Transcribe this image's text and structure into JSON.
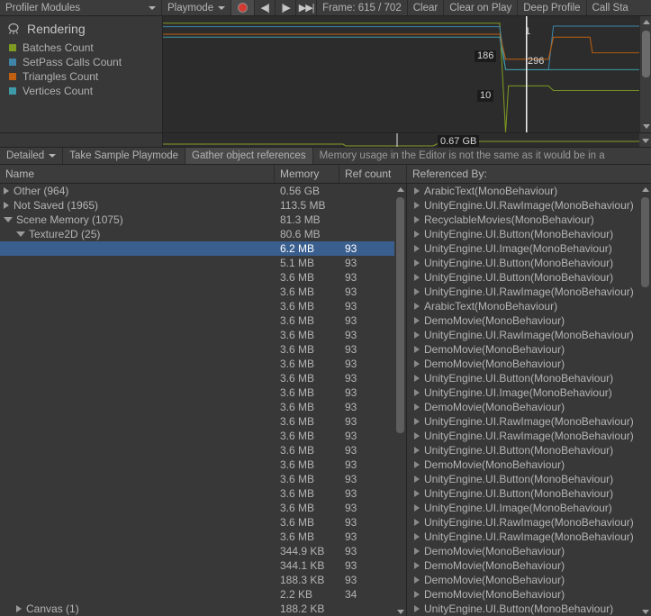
{
  "toolbar": {
    "modules_label": "Profiler Modules",
    "playmode_label": "Playmode",
    "record_icon": "record-icon",
    "prev_frame_icon": "previous-frame-icon",
    "next_frame_icon": "next-frame-icon",
    "last_frame_icon": "last-frame-icon",
    "frame_label": "Frame: 615 / 702",
    "clear_label": "Clear",
    "clear_on_play_label": "Clear on Play",
    "deep_profile_label": "Deep Profile",
    "call_stacks_label": "Call Sta"
  },
  "module": {
    "icon": "rendering-module-icon",
    "title": "Rendering",
    "counters": [
      {
        "label": "Batches Count",
        "color": "#7f9a22"
      },
      {
        "label": "SetPass Calls Count",
        "color": "#3e85a8"
      },
      {
        "label": "Triangles Count",
        "color": "#c06010"
      },
      {
        "label": "Vertices Count",
        "color": "#3e9aa8"
      }
    ]
  },
  "chart_data": {
    "type": "line",
    "title": "Rendering",
    "xlabel": "",
    "ylabel": "",
    "grid": false,
    "legend_position": "left-panel",
    "current_frame": 615,
    "total_frames": 702,
    "playhead_x_frac": 0.745,
    "series": [
      {
        "name": "Batches Count",
        "color": "#7f9a22",
        "current_value": 10,
        "label": "10",
        "points": [
          [
            0.0,
            0.06
          ],
          [
            0.69,
            0.06
          ],
          [
            0.702,
            1.0
          ],
          [
            0.708,
            0.6
          ],
          [
            0.79,
            0.6
          ],
          [
            0.8,
            0.64
          ],
          [
            0.875,
            0.64
          ],
          [
            1.0,
            0.64
          ]
        ]
      },
      {
        "name": "SetPass Calls Count",
        "color": "#3e85a8",
        "current_value": 296,
        "label": "296",
        "points": [
          [
            0.0,
            0.09
          ],
          [
            0.69,
            0.09
          ],
          [
            0.702,
            0.46
          ],
          [
            0.79,
            0.46
          ],
          [
            0.8,
            0.085
          ],
          [
            1.0,
            0.085
          ]
        ]
      },
      {
        "name": "Triangles Count",
        "color": "#c06010",
        "current_value": 186,
        "label": "186",
        "points": [
          [
            0.0,
            0.155
          ],
          [
            0.69,
            0.155
          ],
          [
            0.702,
            0.37
          ],
          [
            0.79,
            0.37
          ],
          [
            0.8,
            0.18
          ],
          [
            0.875,
            0.18
          ],
          [
            0.88,
            0.315
          ],
          [
            1.0,
            0.315
          ]
        ]
      },
      {
        "name": "Vertices Count",
        "color": "#3e9aa8",
        "current_value": 1,
        "label": "1",
        "points": [
          [
            0.0,
            0.18
          ],
          [
            0.69,
            0.18
          ],
          [
            0.702,
            0.46
          ],
          [
            1.0,
            0.46
          ]
        ]
      }
    ],
    "value_labels": [
      {
        "text": "1",
        "x_frac": 0.755,
        "y_frac": 0.085,
        "style": "plain"
      },
      {
        "text": "186",
        "x_frac": 0.655,
        "y_frac": 0.295,
        "style": "boxed"
      },
      {
        "text": "296",
        "x_frac": 0.76,
        "y_frac": 0.335,
        "style": "plain"
      },
      {
        "text": "10",
        "x_frac": 0.66,
        "y_frac": 0.63,
        "style": "boxed"
      }
    ]
  },
  "memory_chart": {
    "type": "area",
    "label": "0.67 GB",
    "label_x_frac": 0.58
  },
  "toolbar2": {
    "detailed_label": "Detailed",
    "take_sample_label": "Take Sample Playmode",
    "gather_refs_label": "Gather object references",
    "note": "Memory usage in the Editor is not the same as it would be in a "
  },
  "table": {
    "headers": {
      "name": "Name",
      "memory": "Memory",
      "ref_count": "Ref count",
      "referenced_by": "Referenced By:"
    },
    "rows": [
      {
        "name": "Other (964)",
        "indent": 0,
        "fold": "closed",
        "memory": "0.56 GB",
        "ref": "",
        "selected": false
      },
      {
        "name": "Not Saved (1965)",
        "indent": 0,
        "fold": "closed",
        "memory": "113.5 MB",
        "ref": "",
        "selected": false
      },
      {
        "name": "Scene Memory (1075)",
        "indent": 0,
        "fold": "open",
        "memory": "81.3 MB",
        "ref": "",
        "selected": false
      },
      {
        "name": "Texture2D (25)",
        "indent": 1,
        "fold": "open",
        "memory": "80.6 MB",
        "ref": "",
        "selected": false
      },
      {
        "name": "",
        "indent": 2,
        "fold": "none",
        "memory": "6.2 MB",
        "ref": "93",
        "selected": true
      },
      {
        "name": "",
        "indent": 2,
        "fold": "none",
        "memory": "5.1 MB",
        "ref": "93",
        "selected": false
      },
      {
        "name": "",
        "indent": 2,
        "fold": "none",
        "memory": "3.6 MB",
        "ref": "93",
        "selected": false
      },
      {
        "name": "",
        "indent": 2,
        "fold": "none",
        "memory": "3.6 MB",
        "ref": "93",
        "selected": false
      },
      {
        "name": "",
        "indent": 2,
        "fold": "none",
        "memory": "3.6 MB",
        "ref": "93",
        "selected": false
      },
      {
        "name": "",
        "indent": 2,
        "fold": "none",
        "memory": "3.6 MB",
        "ref": "93",
        "selected": false
      },
      {
        "name": "",
        "indent": 2,
        "fold": "none",
        "memory": "3.6 MB",
        "ref": "93",
        "selected": false
      },
      {
        "name": "",
        "indent": 2,
        "fold": "none",
        "memory": "3.6 MB",
        "ref": "93",
        "selected": false
      },
      {
        "name": "",
        "indent": 2,
        "fold": "none",
        "memory": "3.6 MB",
        "ref": "93",
        "selected": false
      },
      {
        "name": "",
        "indent": 2,
        "fold": "none",
        "memory": "3.6 MB",
        "ref": "93",
        "selected": false
      },
      {
        "name": "",
        "indent": 2,
        "fold": "none",
        "memory": "3.6 MB",
        "ref": "93",
        "selected": false
      },
      {
        "name": "",
        "indent": 2,
        "fold": "none",
        "memory": "3.6 MB",
        "ref": "93",
        "selected": false
      },
      {
        "name": "",
        "indent": 2,
        "fold": "none",
        "memory": "3.6 MB",
        "ref": "93",
        "selected": false
      },
      {
        "name": "",
        "indent": 2,
        "fold": "none",
        "memory": "3.6 MB",
        "ref": "93",
        "selected": false
      },
      {
        "name": "",
        "indent": 2,
        "fold": "none",
        "memory": "3.6 MB",
        "ref": "93",
        "selected": false
      },
      {
        "name": "",
        "indent": 2,
        "fold": "none",
        "memory": "3.6 MB",
        "ref": "93",
        "selected": false
      },
      {
        "name": "",
        "indent": 2,
        "fold": "none",
        "memory": "3.6 MB",
        "ref": "93",
        "selected": false
      },
      {
        "name": "",
        "indent": 2,
        "fold": "none",
        "memory": "3.6 MB",
        "ref": "93",
        "selected": false
      },
      {
        "name": "",
        "indent": 2,
        "fold": "none",
        "memory": "3.6 MB",
        "ref": "93",
        "selected": false
      },
      {
        "name": "",
        "indent": 2,
        "fold": "none",
        "memory": "3.6 MB",
        "ref": "93",
        "selected": false
      },
      {
        "name": "",
        "indent": 2,
        "fold": "none",
        "memory": "3.6 MB",
        "ref": "93",
        "selected": false
      },
      {
        "name": "",
        "indent": 2,
        "fold": "none",
        "memory": "344.9 KB",
        "ref": "93",
        "selected": false
      },
      {
        "name": "",
        "indent": 2,
        "fold": "none",
        "memory": "344.1 KB",
        "ref": "93",
        "selected": false
      },
      {
        "name": "",
        "indent": 2,
        "fold": "none",
        "memory": "188.3 KB",
        "ref": "93",
        "selected": false
      },
      {
        "name": "",
        "indent": 2,
        "fold": "none",
        "memory": "2.2 KB",
        "ref": "34",
        "selected": false
      },
      {
        "name": "Canvas (1)",
        "indent": 1,
        "fold": "closed",
        "memory": "188.2 KB",
        "ref": "",
        "selected": false
      }
    ],
    "referenced_by": [
      "ArabicText(MonoBehaviour)",
      "UnityEngine.UI.RawImage(MonoBehaviour)",
      "RecyclableMovies(MonoBehaviour)",
      "UnityEngine.UI.Button(MonoBehaviour)",
      "UnityEngine.UI.Image(MonoBehaviour)",
      "UnityEngine.UI.Button(MonoBehaviour)",
      "UnityEngine.UI.Button(MonoBehaviour)",
      "UnityEngine.UI.RawImage(MonoBehaviour)",
      "ArabicText(MonoBehaviour)",
      "DemoMovie(MonoBehaviour)",
      "UnityEngine.UI.RawImage(MonoBehaviour)",
      "DemoMovie(MonoBehaviour)",
      "DemoMovie(MonoBehaviour)",
      "UnityEngine.UI.Button(MonoBehaviour)",
      "UnityEngine.UI.Image(MonoBehaviour)",
      "DemoMovie(MonoBehaviour)",
      "UnityEngine.UI.RawImage(MonoBehaviour)",
      "UnityEngine.UI.RawImage(MonoBehaviour)",
      "UnityEngine.UI.Button(MonoBehaviour)",
      "DemoMovie(MonoBehaviour)",
      "UnityEngine.UI.Button(MonoBehaviour)",
      "UnityEngine.UI.Button(MonoBehaviour)",
      "UnityEngine.UI.Image(MonoBehaviour)",
      "UnityEngine.UI.RawImage(MonoBehaviour)",
      "UnityEngine.UI.RawImage(MonoBehaviour)",
      "DemoMovie(MonoBehaviour)",
      "DemoMovie(MonoBehaviour)",
      "DemoMovie(MonoBehaviour)",
      "DemoMovie(MonoBehaviour)",
      "UnityEngine.UI.Button(MonoBehaviour)"
    ]
  },
  "colors": {
    "selection": "#3a5f8f",
    "panel_bg": "#383838",
    "toolbar_bg": "#3c3c3c",
    "graph_bg": "#2c2c2c",
    "record_red": "#d43b32"
  }
}
